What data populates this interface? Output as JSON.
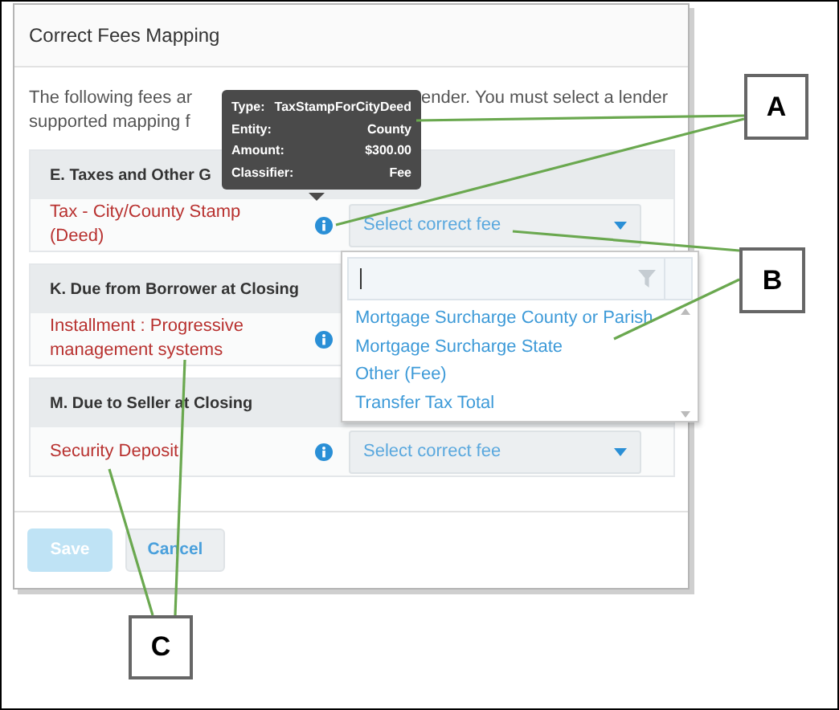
{
  "dialog": {
    "title": "Correct Fees Mapping",
    "description_lines": [
      [
        "The following fees ar",
        "ender. You must select a lender"
      ],
      [
        "supported mapping f"
      ]
    ],
    "sections": [
      {
        "heading": "E. Taxes and Other G",
        "fees": [
          {
            "name": "Tax - City/County Stamp (Deed)",
            "select_placeholder": "Select correct fee"
          }
        ]
      },
      {
        "heading": "K. Due from Borrower at Closing",
        "fees": [
          {
            "name": "Installment : Progressive management systems"
          }
        ]
      },
      {
        "heading": "M. Due to Seller at Closing",
        "fees": [
          {
            "name": "Security Deposit",
            "select_placeholder": "Select correct fee"
          }
        ]
      }
    ],
    "buttons": [
      {
        "label": "Save",
        "disabled": true
      },
      {
        "label": "Cancel",
        "disabled": false
      }
    ]
  },
  "tooltip": {
    "rows": [
      {
        "label": "Type:",
        "value": "TaxStampForCityDeed"
      },
      {
        "label": "Entity:",
        "value": "County"
      },
      {
        "label": "Amount:",
        "value": "$300.00"
      },
      {
        "label": "Classifier:",
        "value": "Fee"
      }
    ]
  },
  "dropdown": {
    "options": [
      "Mortgage Surcharge County or Parish",
      "Mortgage Surcharge State",
      "Other (Fee)",
      "Transfer Tax Total"
    ]
  },
  "callouts": [
    {
      "label": "A"
    },
    {
      "label": "B"
    },
    {
      "label": "C"
    }
  ]
}
